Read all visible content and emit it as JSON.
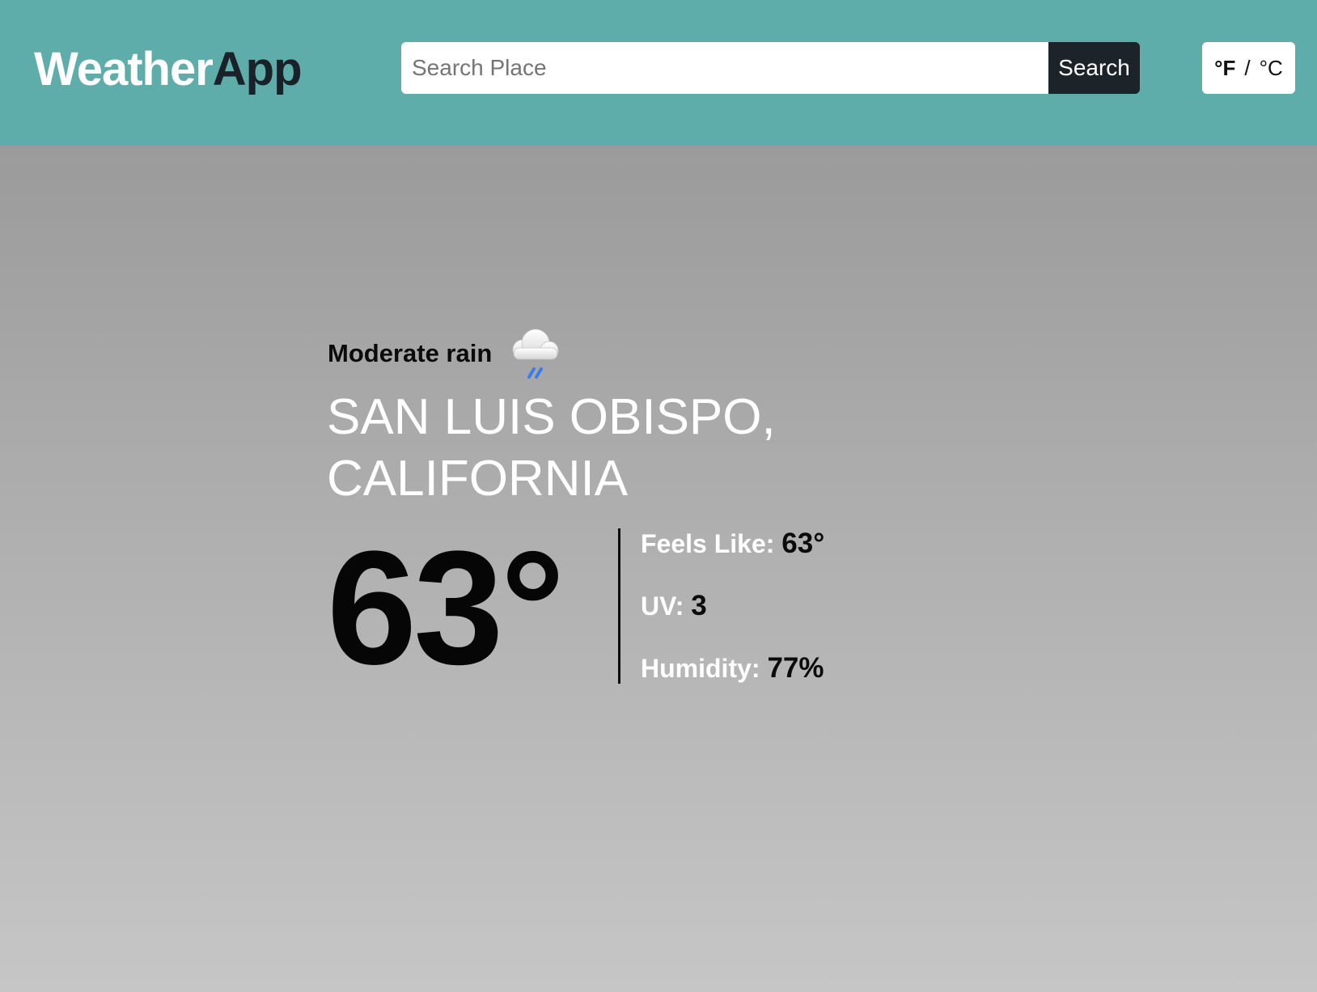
{
  "header": {
    "logo_part1": "Weather",
    "logo_part2": "App",
    "search_placeholder": "Search Place",
    "search_value": "",
    "search_button_label": "Search",
    "unit_f": "°F",
    "unit_separator": "/",
    "unit_c": "°C",
    "active_unit": "°F",
    "brand_color": "#5fadaa"
  },
  "weather": {
    "condition": "Moderate rain",
    "condition_icon": "rain-cloud-icon",
    "location": "SAN LUIS OBISPO, CALIFORNIA",
    "temperature": "63°",
    "details": [
      {
        "label": "Feels Like:",
        "value": "63°"
      },
      {
        "label": "UV:",
        "value": "3"
      },
      {
        "label": "Humidity:",
        "value": "77%"
      }
    ]
  }
}
